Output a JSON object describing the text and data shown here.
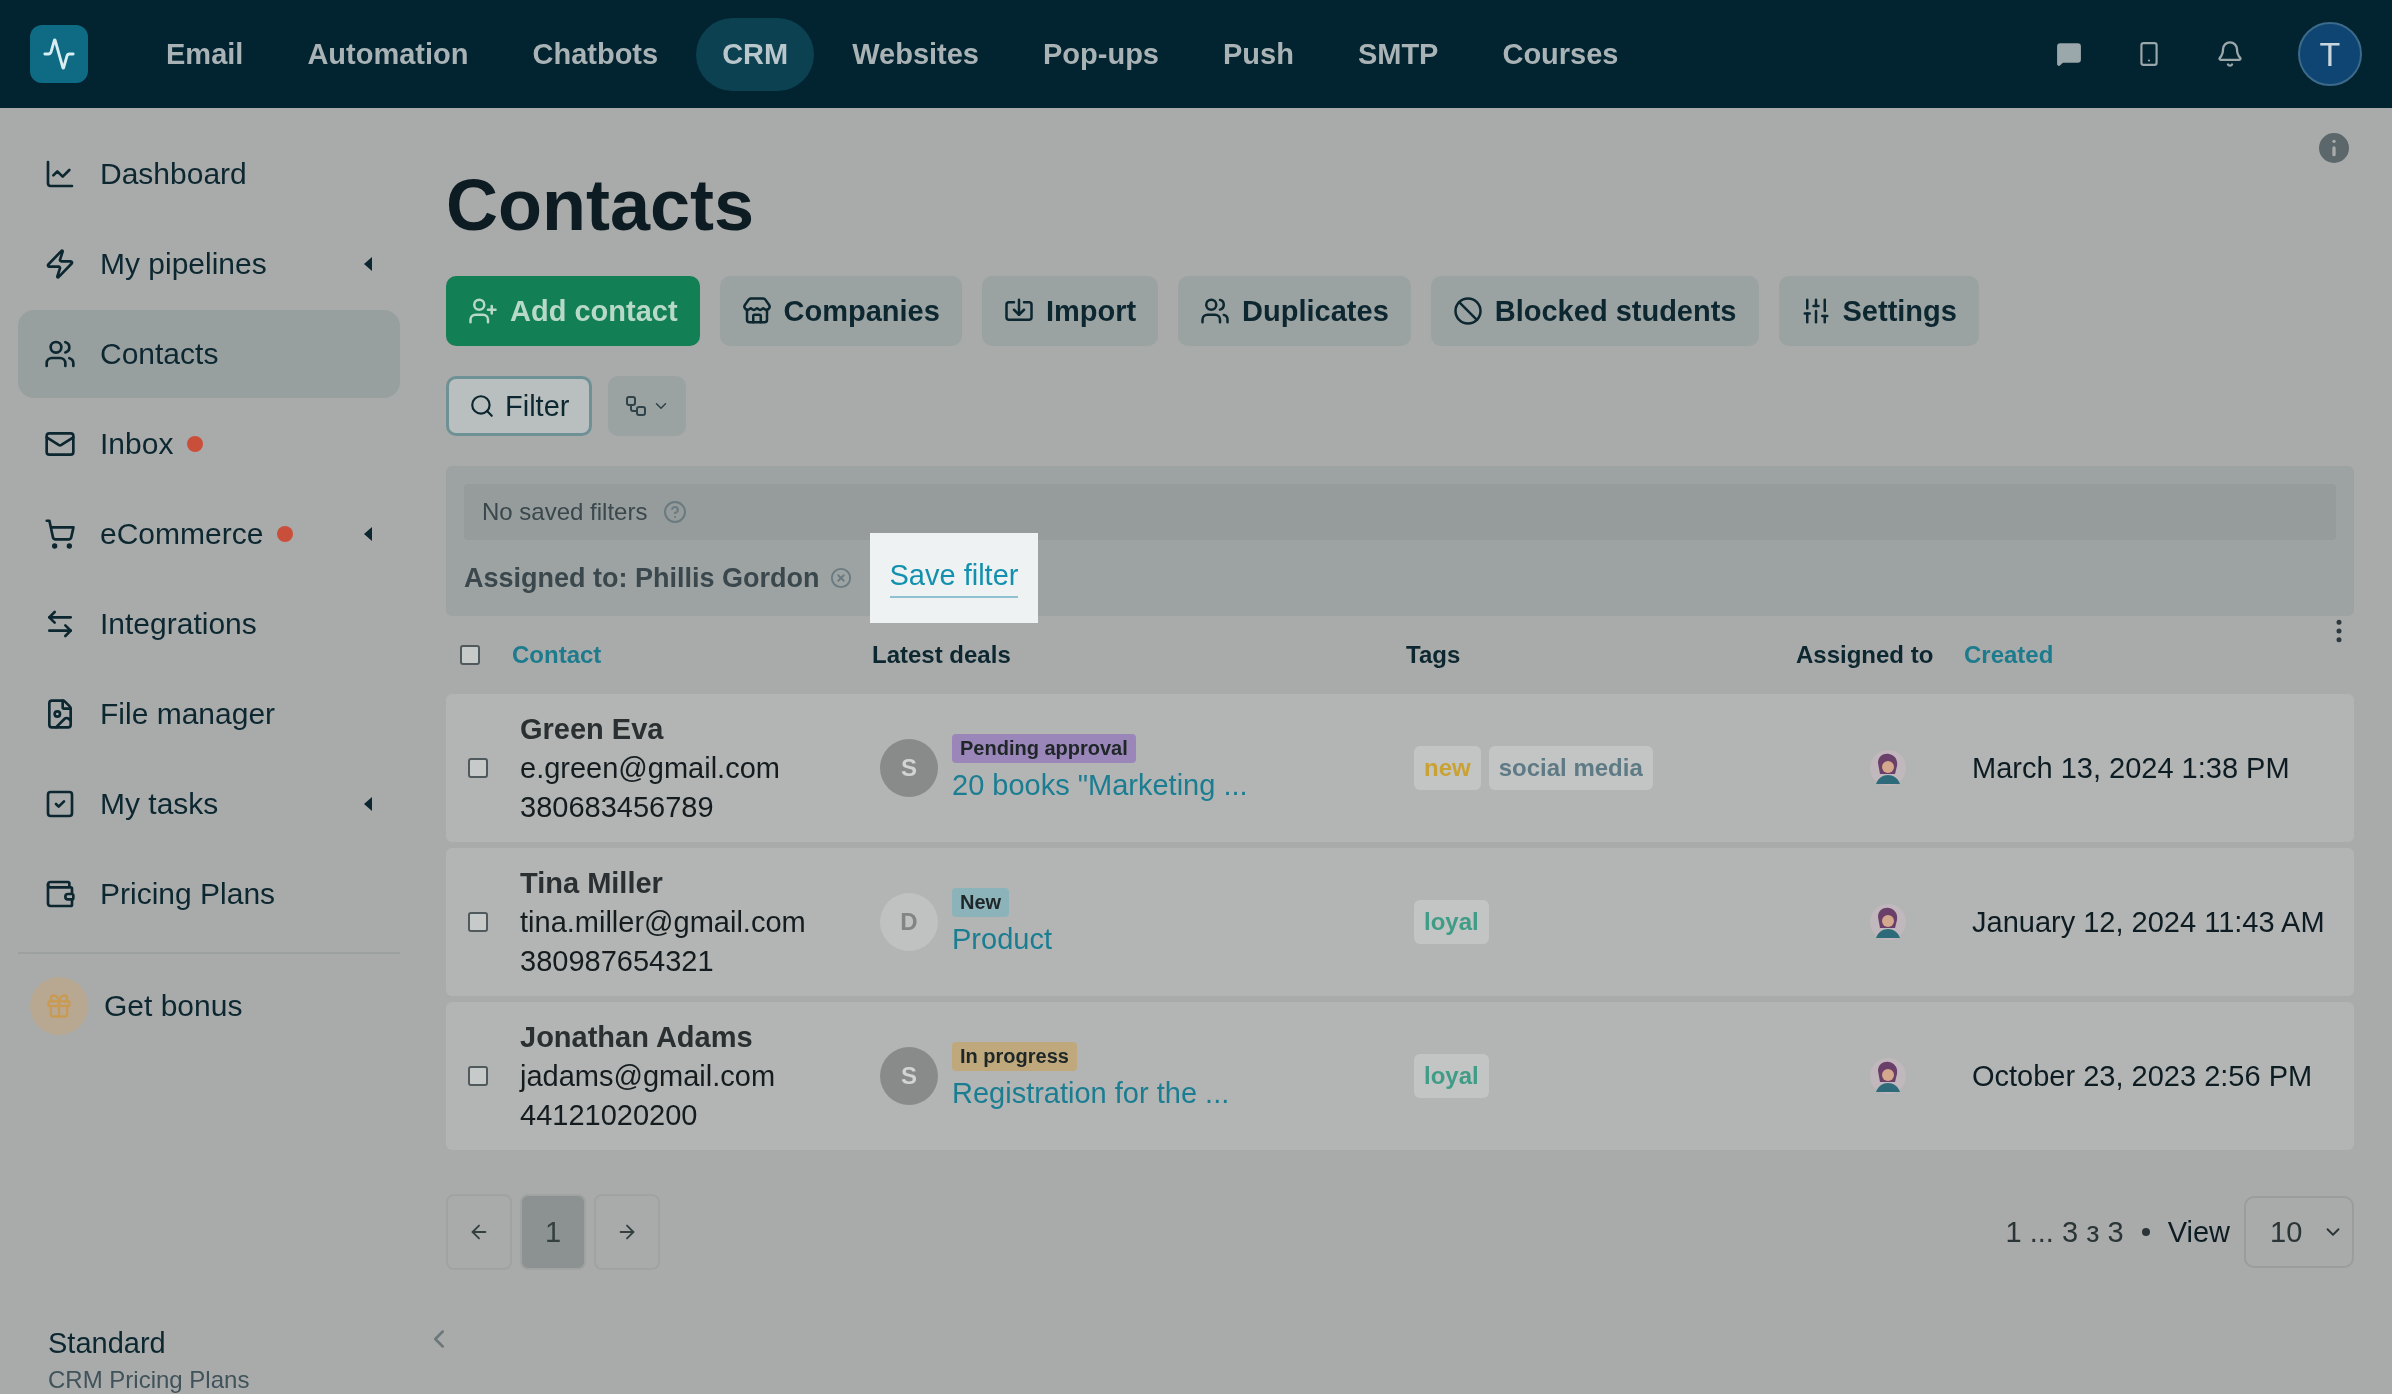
{
  "nav": {
    "items": [
      {
        "label": "Email",
        "selected": false
      },
      {
        "label": "Automation",
        "selected": false
      },
      {
        "label": "Chatbots",
        "selected": false
      },
      {
        "label": "CRM",
        "selected": true
      },
      {
        "label": "Websites",
        "selected": false
      },
      {
        "label": "Pop-ups",
        "selected": false
      },
      {
        "label": "Push",
        "selected": false
      },
      {
        "label": "SMTP",
        "selected": false
      },
      {
        "label": "Courses",
        "selected": false
      }
    ],
    "avatar": "T"
  },
  "sidebar": {
    "items": [
      {
        "label": "Dashboard",
        "selected": false,
        "dot": false,
        "expandable": false
      },
      {
        "label": "My pipelines",
        "selected": false,
        "dot": false,
        "expandable": true
      },
      {
        "label": "Contacts",
        "selected": true,
        "dot": false,
        "expandable": false
      },
      {
        "label": "Inbox",
        "selected": false,
        "dot": true,
        "expandable": false
      },
      {
        "label": "eCommerce",
        "selected": false,
        "dot": true,
        "expandable": true
      },
      {
        "label": "Integrations",
        "selected": false,
        "dot": false,
        "expandable": false
      },
      {
        "label": "File manager",
        "selected": false,
        "dot": false,
        "expandable": false
      },
      {
        "label": "My tasks",
        "selected": false,
        "dot": false,
        "expandable": true
      },
      {
        "label": "Pricing Plans",
        "selected": false,
        "dot": false,
        "expandable": false
      }
    ],
    "bonus": "Get bonus",
    "plan": {
      "name": "Standard",
      "subtitle": "CRM Pricing Plans"
    }
  },
  "title": "Contacts",
  "actions": [
    {
      "label": "Add contact",
      "kind": "primary"
    },
    {
      "label": "Companies",
      "kind": "secondary"
    },
    {
      "label": "Import",
      "kind": "secondary"
    },
    {
      "label": "Duplicates",
      "kind": "secondary"
    },
    {
      "label": "Blocked students",
      "kind": "secondary"
    },
    {
      "label": "Settings",
      "kind": "secondary"
    }
  ],
  "filter_button": "Filter",
  "filters": {
    "saved": "No saved filters",
    "active": "Assigned to: Phillis Gordon",
    "save_link": "Save filter",
    "save_highlighted": true
  },
  "table": {
    "all_checked": false,
    "columns": [
      {
        "label": "Contact",
        "sortable": true
      },
      {
        "label": "Latest deals",
        "sortable": false
      },
      {
        "label": "Tags",
        "sortable": false
      },
      {
        "label": "Assigned to",
        "sortable": false
      },
      {
        "label": "Created",
        "sortable": true
      }
    ],
    "rows": [
      {
        "checked": false,
        "name": "Green Eva",
        "email": "e.green@gmail.com",
        "phone": "380683456789",
        "deal": {
          "initial": "S",
          "faded": false,
          "status": "Pending approval",
          "color": "#9a86b8",
          "title": "20 books \"Marketing ..."
        },
        "tags": [
          {
            "label": "new",
            "color": "#c9a235"
          },
          {
            "label": "social media",
            "color": "#5e7a85"
          }
        ],
        "created": "March 13, 2024 1:38 PM"
      },
      {
        "checked": false,
        "name": "Tina Miller",
        "email": "tina.miller@gmail.com",
        "phone": "380987654321",
        "deal": {
          "initial": "D",
          "faded": true,
          "status": "New",
          "color": "#8db3ba",
          "title": "Product"
        },
        "tags": [
          {
            "label": "loyal",
            "color": "#3f9c86"
          }
        ],
        "created": "January 12, 2024 11:43 AM"
      },
      {
        "checked": false,
        "name": "Jonathan Adams",
        "email": "jadams@gmail.com",
        "phone": "44121020200",
        "deal": {
          "initial": "S",
          "faded": false,
          "status": "In progress",
          "color": "#bfa97c",
          "title": "Registration for the ..."
        },
        "tags": [
          {
            "label": "loyal",
            "color": "#3f9c86"
          }
        ],
        "created": "October 23, 2023 2:56 PM"
      }
    ]
  },
  "pagination": {
    "pages": [
      {
        "label": "1",
        "selected": true
      }
    ],
    "summary": "1 ... 3 з 3",
    "view_label": "View",
    "per_page": "10"
  }
}
